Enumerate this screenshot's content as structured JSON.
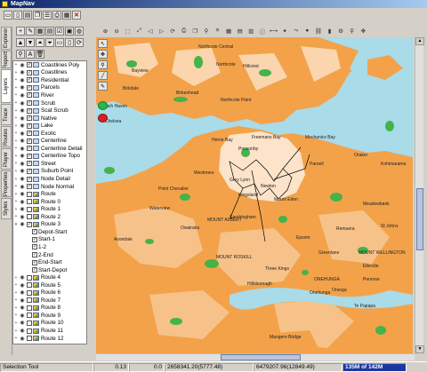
{
  "window": {
    "title": "MapNav"
  },
  "side_tabs": [
    "Explorer",
    "Reports",
    "Layers",
    "Trace",
    "Routes",
    "Player",
    "Properties",
    "Styles"
  ],
  "layers": [
    {
      "label": "Coastlines Poly",
      "checked": true,
      "kind": "layer"
    },
    {
      "label": "Coastlines",
      "checked": true,
      "kind": "layer"
    },
    {
      "label": "Residential",
      "checked": true,
      "kind": "layer"
    },
    {
      "label": "Parcels",
      "checked": true,
      "kind": "layer"
    },
    {
      "label": "River",
      "checked": true,
      "kind": "layer"
    },
    {
      "label": "Scrub",
      "checked": true,
      "kind": "layer"
    },
    {
      "label": "Scat Scrub",
      "checked": true,
      "kind": "layer"
    },
    {
      "label": "Native",
      "checked": true,
      "kind": "layer"
    },
    {
      "label": "Lake",
      "checked": true,
      "kind": "layer"
    },
    {
      "label": "Exotic",
      "checked": true,
      "kind": "layer"
    },
    {
      "label": "Centerline",
      "checked": true,
      "kind": "layer"
    },
    {
      "label": "Centerline Detail",
      "checked": true,
      "kind": "layer"
    },
    {
      "label": "Centerline Topo",
      "checked": true,
      "kind": "layer"
    },
    {
      "label": "Street",
      "checked": true,
      "kind": "layer"
    },
    {
      "label": "Suburb Point",
      "checked": true,
      "kind": "layer"
    },
    {
      "label": "Node Detail",
      "checked": true,
      "kind": "layer"
    },
    {
      "label": "Node Normal",
      "checked": true,
      "kind": "layer"
    },
    {
      "label": "Route",
      "checked": false,
      "kind": "route"
    },
    {
      "label": "Route 0",
      "checked": false,
      "kind": "route"
    },
    {
      "label": "Route 1",
      "checked": false,
      "kind": "route"
    },
    {
      "label": "Route 2",
      "checked": false,
      "kind": "route"
    },
    {
      "label": "Route 3",
      "checked": true,
      "kind": "route",
      "expanded": true
    },
    {
      "label": "Depot-Start",
      "checked": true,
      "kind": "sub"
    },
    {
      "label": "Start-1",
      "checked": true,
      "kind": "sub"
    },
    {
      "label": "1-2",
      "checked": true,
      "kind": "sub"
    },
    {
      "label": "2-End",
      "checked": true,
      "kind": "sub"
    },
    {
      "label": "End-Start",
      "checked": true,
      "kind": "sub"
    },
    {
      "label": "Start-Depot",
      "checked": true,
      "kind": "sub"
    },
    {
      "label": "Route 4",
      "checked": false,
      "kind": "route"
    },
    {
      "label": "Route 5",
      "checked": false,
      "kind": "route"
    },
    {
      "label": "Route 6",
      "checked": false,
      "kind": "route"
    },
    {
      "label": "Route 7",
      "checked": false,
      "kind": "route"
    },
    {
      "label": "Route 8",
      "checked": false,
      "kind": "route"
    },
    {
      "label": "Route 9",
      "checked": false,
      "kind": "route"
    },
    {
      "label": "Route 10",
      "checked": false,
      "kind": "route"
    },
    {
      "label": "Route 11",
      "checked": false,
      "kind": "route"
    },
    {
      "label": "Route 12",
      "checked": false,
      "kind": "route"
    }
  ],
  "map_labels": [
    "Northcote Central",
    "Northcote",
    "Hillcrest",
    "Bayview",
    "Birkdale",
    "Beach Haven",
    "Birkenhead",
    "Chelsea",
    "Northcote Point",
    "Herne Bay",
    "Freemans Bay",
    "Ponsonby",
    "Mechanics Bay",
    "Parnell",
    "Grey Lynn",
    "Newton",
    "Point Chevalier",
    "Westmere",
    "Waterview",
    "Kingsland",
    "Mount Eden",
    "Sandringham",
    "MOUNT ALBERT",
    "Avondale",
    "Owairaka",
    "MOUNT ROSKILL",
    "Three Kings",
    "Epsom",
    "Greenlane",
    "Remuera",
    "Ellerslie",
    "Hillsborough",
    "Onehunga",
    "ONEHUNGA",
    "Mangere Bridge",
    "Oranga",
    "Penrose",
    "MOUNT WELLINGTON",
    "Te Papapa",
    "Meadowbank",
    "St Johns",
    "Kohimarama",
    "Orakei"
  ],
  "status": {
    "tool": "Selection Tool",
    "scale": "0.13",
    "angle": "0.0",
    "x": "2658341.20(5777.48)",
    "y": "6479207.96(12849.49)",
    "memory": "135M of 142M"
  },
  "colors": {
    "water": "#a9dbe9",
    "land": "#f3a24a",
    "urban": "#ffffff",
    "park": "#44b34a",
    "route": "#000000"
  }
}
